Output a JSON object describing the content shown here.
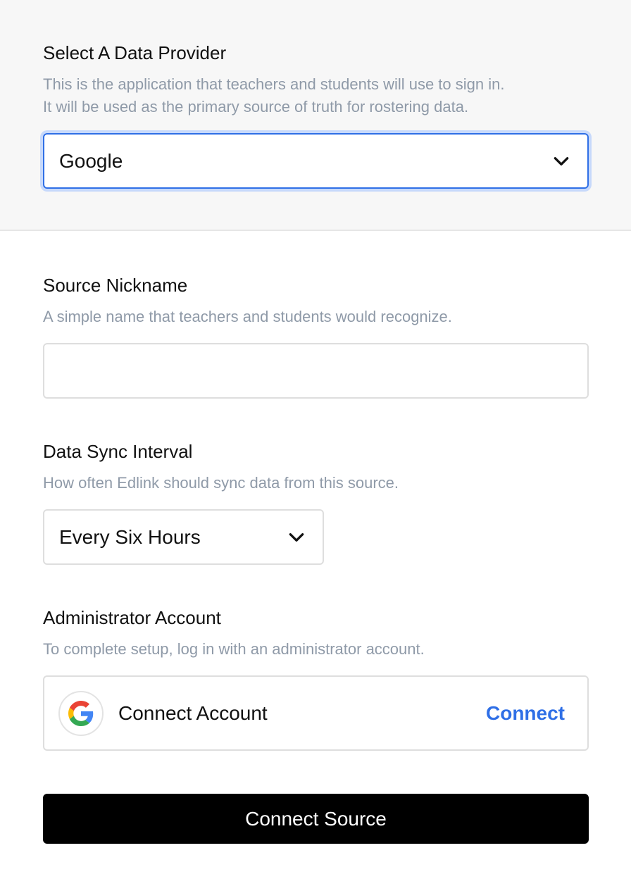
{
  "provider": {
    "title": "Select A Data Provider",
    "description_line1": "This is the application that teachers and students will use to sign in.",
    "description_line2": "It will be used as the primary source of truth for rostering data.",
    "selected": "Google"
  },
  "nickname": {
    "title": "Source Nickname",
    "description": "A simple name that teachers and students would recognize.",
    "value": "",
    "placeholder": ""
  },
  "sync_interval": {
    "title": "Data Sync Interval",
    "description": "How often Edlink should sync data from this source.",
    "selected": "Every Six Hours"
  },
  "admin_account": {
    "title": "Administrator Account",
    "description": "To complete setup, log in with an administrator account.",
    "account_label": "Connect Account",
    "connect_label": "Connect",
    "icon": "google-logo-icon"
  },
  "submit": {
    "label": "Connect Source"
  },
  "colors": {
    "accent": "#2f6fe6",
    "focus_ring": "#c7d9fb",
    "muted_text": "#8f9aa8",
    "top_background": "#f7f7f7",
    "button_background": "#000000"
  }
}
